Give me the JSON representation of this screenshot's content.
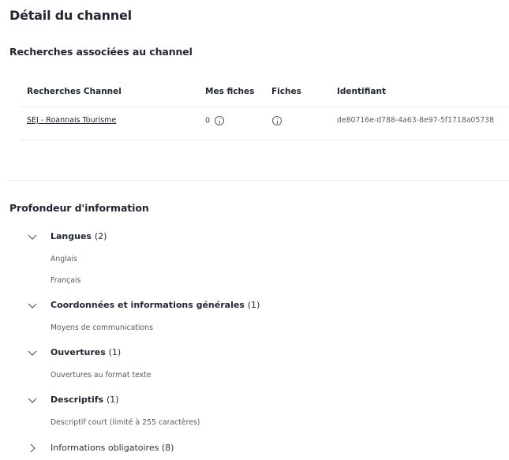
{
  "page": {
    "title": "Détail du channel"
  },
  "searches_section": {
    "title": "Recherches associées au channel",
    "columns": [
      "Recherches Channel",
      "Mes fiches",
      "Fiches",
      "Identifiant"
    ],
    "rows": [
      {
        "name": "SEJ - Roannais Tourisme",
        "my_cards": "0",
        "identifier": "de80716e-d788-4a63-8e97-5f1718a05738"
      }
    ]
  },
  "depth_section": {
    "title": "Profondeur d'information",
    "groups": [
      {
        "label": "Langues",
        "count": "(2)",
        "expanded": true,
        "items": [
          "Anglais",
          "Français"
        ]
      },
      {
        "label": "Coordonnées et informations générales",
        "count": "(1)",
        "expanded": true,
        "items": [
          "Moyens de communications"
        ]
      },
      {
        "label": "Ouvertures",
        "count": "(1)",
        "expanded": true,
        "items": [
          "Ouvertures au format texte"
        ]
      },
      {
        "label": "Descriptifs",
        "count": "(1)",
        "expanded": true,
        "items": [
          "Descriptif court (limité à 255 caractères)"
        ]
      },
      {
        "label": "Informations obligatoires",
        "count": "(8)",
        "expanded": false,
        "items": []
      }
    ]
  },
  "icons": {
    "info": "info-circle-icon",
    "expand": "chevron-down-icon",
    "collapse": "chevron-right-icon"
  },
  "colors": {
    "text": "#232733",
    "muted": "#555963",
    "divider": "#e6e8ec"
  }
}
